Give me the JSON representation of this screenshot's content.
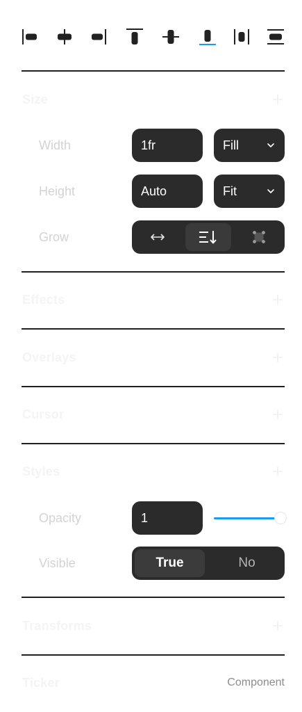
{
  "align_tools": [
    {
      "name": "align-left-icon"
    },
    {
      "name": "align-horizontal-center-icon"
    },
    {
      "name": "align-right-icon"
    },
    {
      "name": "align-top-icon"
    },
    {
      "name": "align-vertical-center-icon"
    },
    {
      "name": "align-bottom-icon"
    },
    {
      "name": "distribute-horizontal-icon"
    },
    {
      "name": "distribute-vertical-icon"
    }
  ],
  "sections": {
    "size": {
      "title": "Size"
    },
    "effects": {
      "title": "Effects"
    },
    "overlays": {
      "title": "Overlays"
    },
    "cursor": {
      "title": "Cursor"
    },
    "styles": {
      "title": "Styles"
    },
    "transforms": {
      "title": "Transforms"
    },
    "ticker": {
      "title": "Ticker",
      "tag": "Component"
    }
  },
  "size": {
    "width": {
      "label": "Width",
      "value": "1fr",
      "mode": "Fill"
    },
    "height": {
      "label": "Height",
      "value": "Auto",
      "mode": "Fit"
    },
    "grow": {
      "label": "Grow",
      "options": [
        {
          "icon": "horizontal-arrows-icon",
          "active": false
        },
        {
          "icon": "stack-down-icon",
          "active": true
        },
        {
          "icon": "fixed-corners-icon",
          "active": false
        }
      ]
    }
  },
  "styles": {
    "opacity": {
      "label": "Opacity",
      "value": "1",
      "slider_fraction": 1.0
    },
    "visible": {
      "label": "Visible",
      "options": [
        "True",
        "No"
      ],
      "selected": "True"
    }
  },
  "colors": {
    "accent": "#1a9bef",
    "control_bg": "#2b2b2b",
    "divider": "#1f1f1f"
  }
}
